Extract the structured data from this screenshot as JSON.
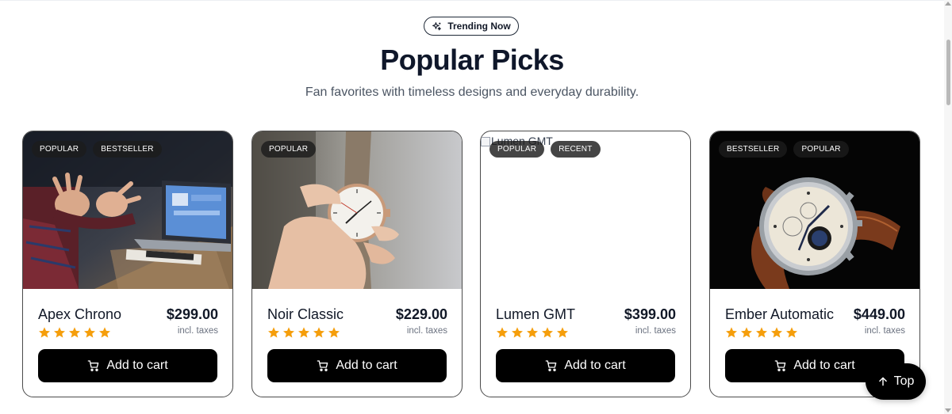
{
  "header": {
    "pill_icon": "sparkles-icon",
    "pill_label": "Trending Now",
    "title": "Popular Picks",
    "subtitle": "Fan favorites with timeless designs and everyday durability."
  },
  "products": [
    {
      "name": "Apex Chrono",
      "price": "$299.00",
      "tax_note": "incl. taxes",
      "rating": 5,
      "badges": [
        "POPULAR",
        "BESTSELLER"
      ],
      "image": "laptop-workspace-photo",
      "button_label": "Add to cart"
    },
    {
      "name": "Noir Classic",
      "price": "$229.00",
      "tax_note": "incl. taxes",
      "rating": 5,
      "badges": [
        "POPULAR"
      ],
      "image": "hand-holding-watch-photo",
      "button_label": "Add to cart"
    },
    {
      "name": "Lumen GMT",
      "price": "$399.00",
      "tax_note": "incl. taxes",
      "rating": 5,
      "badges": [
        "POPULAR",
        "RECENT"
      ],
      "image_alt": "Lumen GMT",
      "image": "broken-image",
      "button_label": "Add to cart"
    },
    {
      "name": "Ember Automatic",
      "price": "$449.00",
      "tax_note": "incl. taxes",
      "rating": 5,
      "badges": [
        "BESTSELLER",
        "POPULAR"
      ],
      "image": "chronograph-watch-photo",
      "button_label": "Add to cart"
    }
  ],
  "top_button": {
    "label": "Top",
    "icon": "arrow-up-icon"
  },
  "colors": {
    "accent": "#000000",
    "star": "#f59e0b",
    "title": "#0f172a"
  }
}
